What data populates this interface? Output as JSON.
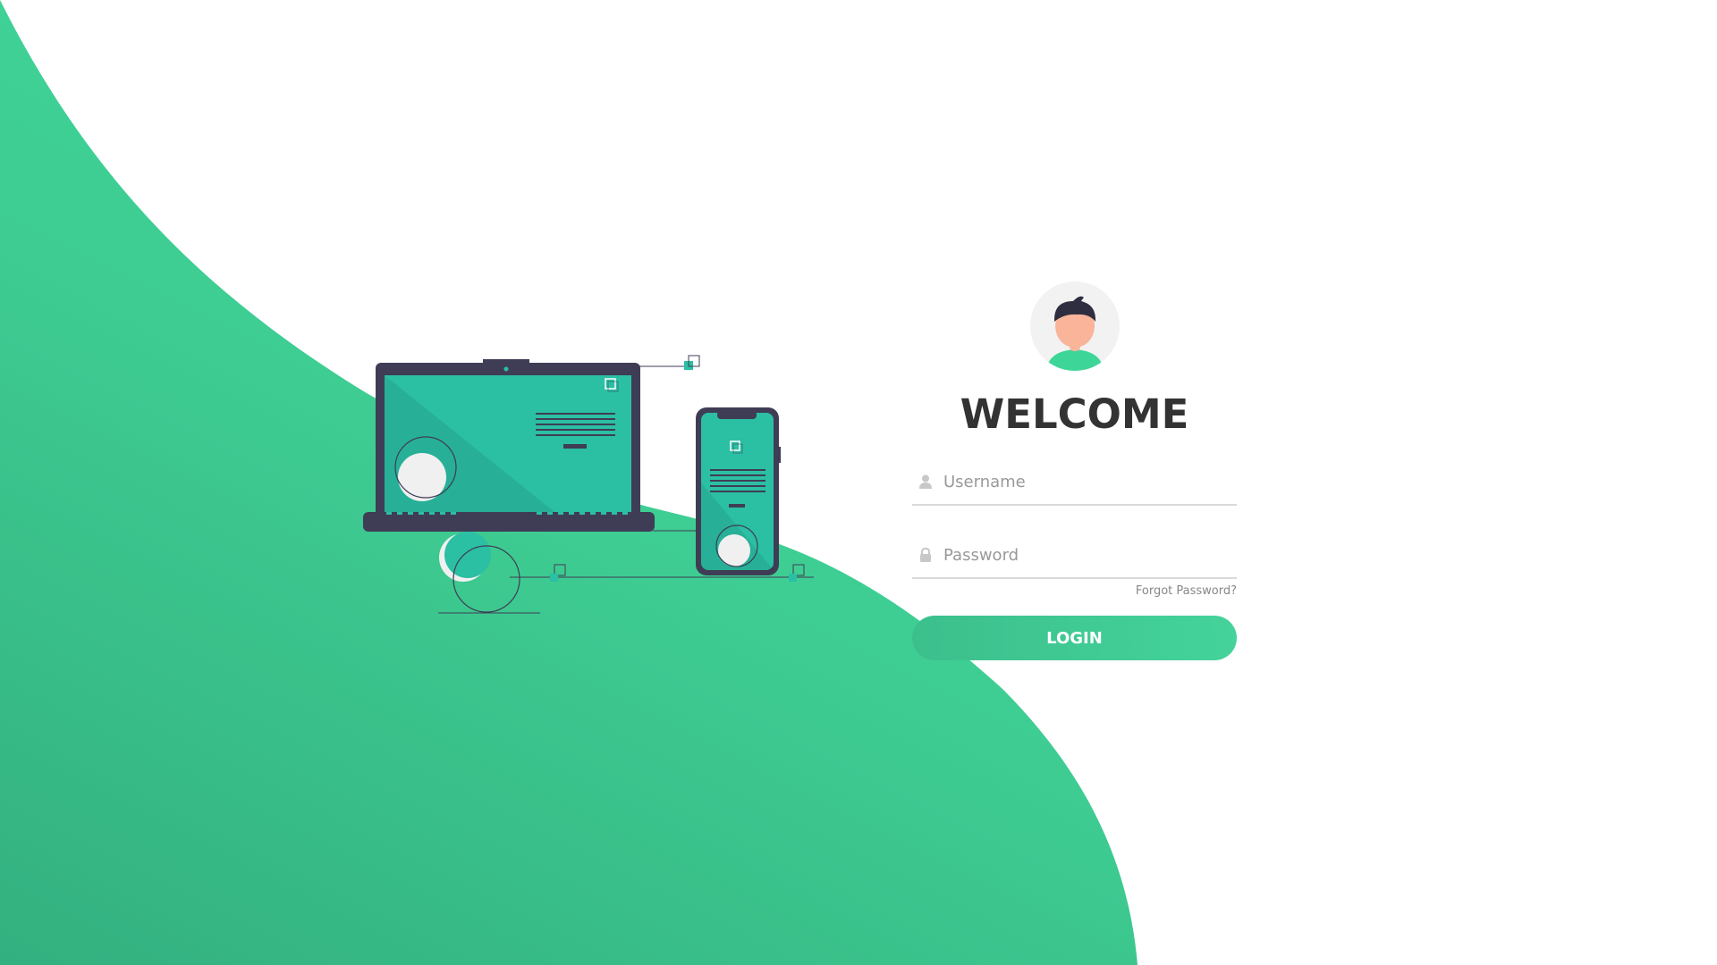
{
  "colors": {
    "accent": "#3ed598",
    "accent_dark": "#33b07f",
    "device_frame": "#3f3d56",
    "screen_teal": "#2bbfa4",
    "title_text": "#333333",
    "placeholder_text": "#999999"
  },
  "illustration": {
    "name": "laptop-and-phone-illustration"
  },
  "login": {
    "avatar_icon": "user-avatar-icon",
    "title": "WELCOME",
    "username": {
      "icon": "user-icon",
      "placeholder": "Username",
      "value": ""
    },
    "password": {
      "icon": "lock-icon",
      "placeholder": "Password",
      "value": ""
    },
    "forgot_label": "Forgot Password?",
    "submit_label": "LOGIN"
  }
}
